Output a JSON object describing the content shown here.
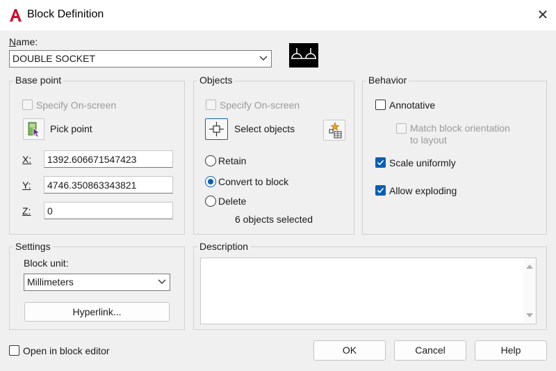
{
  "window": {
    "title": "Block Definition",
    "close_glyph": "✕"
  },
  "name": {
    "label_first": "N",
    "label_rest": "ame:",
    "value": "DOUBLE SOCKET"
  },
  "base_point": {
    "title": "Base point",
    "specify_on_screen": "Specify On-screen",
    "pick_point": "Pick point",
    "x_label": "X:",
    "y_label": "Y:",
    "z_label": "Z:",
    "x_value": "1392.606671547423",
    "y_value": "4746.350863343821",
    "z_value": "0"
  },
  "objects": {
    "title": "Objects",
    "specify_on_screen": "Specify On-screen",
    "select_objects": "Select objects",
    "retain": "Retain",
    "convert_to_block": "Convert to block",
    "delete": "Delete",
    "count_text": "6 objects selected",
    "selected_option": "convert_to_block"
  },
  "behavior": {
    "title": "Behavior",
    "annotative": "Annotative",
    "annotative_checked": false,
    "match_orientation_line1": "Match block orientation",
    "match_orientation_line2": "to layout",
    "scale_uniformly": "Scale uniformly",
    "scale_uniformly_checked": true,
    "allow_exploding": "Allow exploding",
    "allow_exploding_checked": true
  },
  "settings": {
    "title": "Settings",
    "block_unit_label": "Block unit:",
    "block_unit_value": "Millimeters",
    "hyperlink_button": "Hyperlink..."
  },
  "description": {
    "title": "Description",
    "value": ""
  },
  "footer": {
    "open_in_editor": "Open in block editor",
    "open_in_editor_checked": false,
    "ok": "OK",
    "cancel": "Cancel",
    "help": "Help"
  },
  "colors": {
    "accent": "#0a5fb4",
    "app_icon_red": "#c8102e",
    "preview_bg": "#000000"
  },
  "icons": [
    "autocad-logo-icon",
    "close-icon",
    "chevron-down-icon",
    "pick-point-icon",
    "select-objects-icon",
    "quick-select-icon",
    "checkmark-icon",
    "scroll-up-icon",
    "scroll-down-icon",
    "block-preview"
  ]
}
